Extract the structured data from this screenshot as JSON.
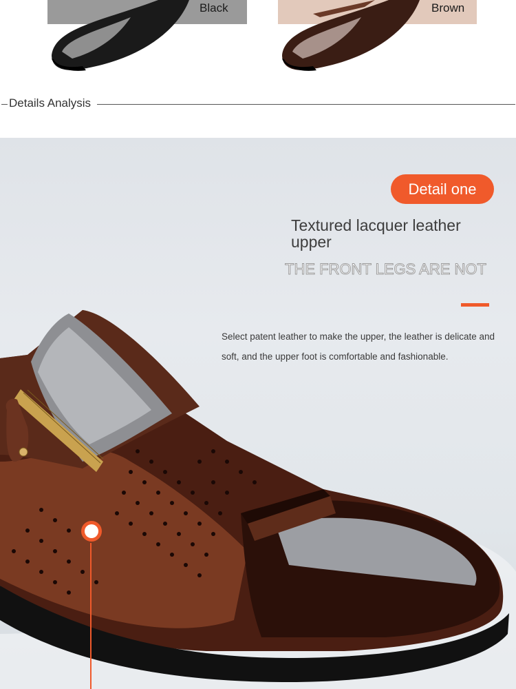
{
  "swatches": {
    "black_label": "Black",
    "brown_label": "Brown"
  },
  "section": {
    "title": "Details Analysis"
  },
  "detail": {
    "badge": "Detail one",
    "headline": "Textured lacquer leather upper",
    "subhead": "THE FRONT LEGS ARE NOT",
    "description": "Select patent leather to make the upper, the leather is delicate and soft, and the upper foot is comfortable and fashionable."
  },
  "colors": {
    "accent": "#f05a2b",
    "black_swatch": "#9a9a9a",
    "brown_swatch": "#e2c9bb"
  }
}
